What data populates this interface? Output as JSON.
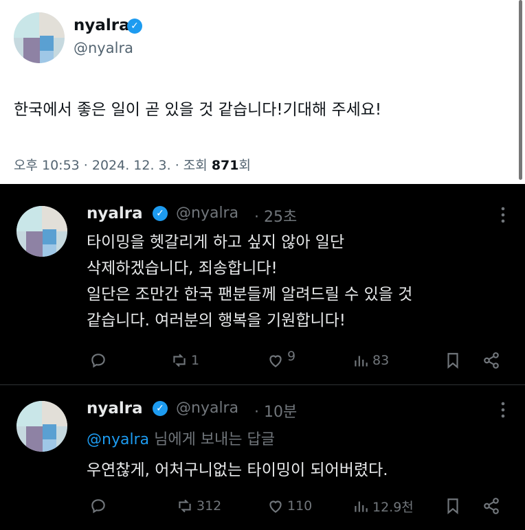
{
  "main_tweet": {
    "name": "nyalra",
    "handle": "@nyalra",
    "text": "한국에서 좋은 일이 곧 있을 것 같습니다!기대해 주세요!",
    "meta_prefix": "오후 10:53 · 2024. 12. 3. · 조회 ",
    "views": "871",
    "views_suffix": "회"
  },
  "replies": [
    {
      "name": "nyalra",
      "handle": "@nyalra",
      "time": "· 25초",
      "text": "타이밍을 헷갈리게 하고 싶지 않아 일단\n삭제하겠습니다, 죄송합니다!\n일단은 조만간 한국 팬분들께 알려드릴 수 있을 것\n같습니다. 여러분의 행복을 기원합니다!",
      "reposts": "1",
      "likes": "9",
      "views": "83"
    },
    {
      "name": "nyalra",
      "handle": "@nyalra",
      "time": "· 10분",
      "reply_to_handle": "@nyalra",
      "reply_to_suffix": " 님에게 보내는 답글",
      "text": "우연찮게, 어처구니없는 타이밍이 되어버렸다.",
      "reposts": "312",
      "likes": "110",
      "views": "12.9천"
    }
  ],
  "colors": {
    "verified_blue": "#1d9bf0",
    "dark_background": "#000000",
    "muted_text": "#71767b",
    "mention_blue": "#1d9bf0"
  },
  "icons": [
    "verified-badge-icon",
    "more-icon",
    "reply-icon",
    "repost-icon",
    "like-icon",
    "views-icon",
    "bookmark-icon",
    "share-icon"
  ]
}
